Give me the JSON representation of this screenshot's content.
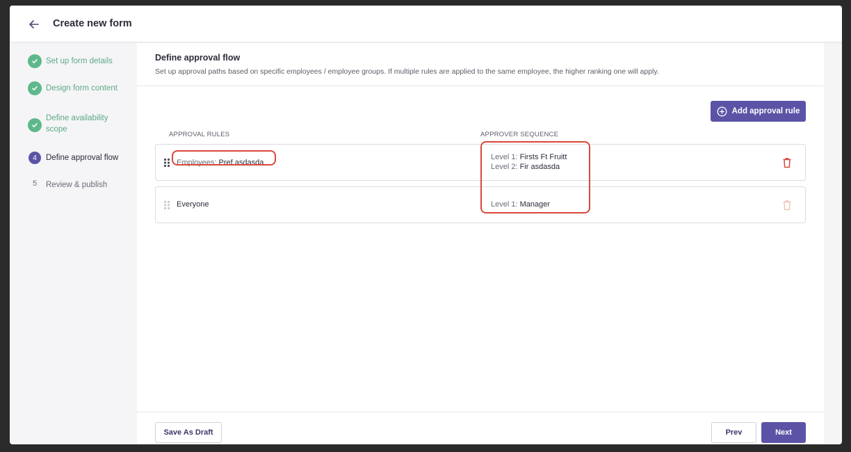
{
  "header": {
    "title": "Create new form"
  },
  "steps": [
    {
      "label": "Set up form details",
      "state": "done"
    },
    {
      "label": "Design form content",
      "state": "done"
    },
    {
      "label": "Define availability scope",
      "state": "done"
    },
    {
      "num": "4",
      "label": "Define approval flow",
      "state": "active"
    },
    {
      "num": "5",
      "label": "Review & publish",
      "state": "todo"
    }
  ],
  "main": {
    "title": "Define approval flow",
    "description": "Set up approval paths based on specific employees / employee groups. If multiple rules are applied to the same employee, the higher ranking one will apply.",
    "add_rule_label": "Add approval rule",
    "columns": {
      "rules": "APPROVAL RULES",
      "sequence": "APPROVER SEQUENCE"
    },
    "rules": [
      {
        "key": "Employees:",
        "value": "Pref asdasda",
        "levels": [
          {
            "label": "Level 1:",
            "value": "Firsts Ft Fruitt"
          },
          {
            "label": "Level 2:",
            "value": "Fir asdasda"
          }
        ]
      },
      {
        "value": "Everyone",
        "levels": [
          {
            "label": "Level 1:",
            "value": "Manager"
          }
        ]
      }
    ]
  },
  "footer": {
    "draft_label": "Save As Draft",
    "prev_label": "Prev",
    "next_label": "Next"
  },
  "colors": {
    "accent": "#5b54a6",
    "success": "#5fb88c",
    "danger": "#d8473b"
  }
}
